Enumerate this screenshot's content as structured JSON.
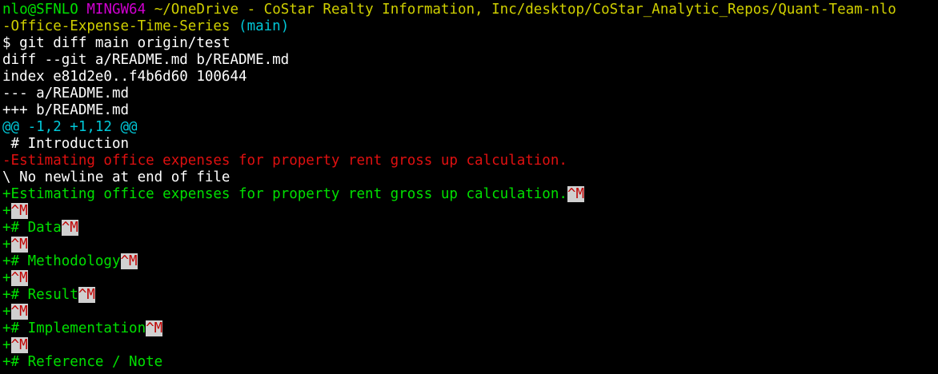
{
  "prompt": {
    "user_host": "nlo@SFNLO",
    "system": "MINGW64",
    "path_line1": "~/OneDrive - CoStar Realty Information, Inc/desktop/CoStar_Analytic_Repos/Quant-Team-nlo",
    "path_line2": "-Office-Expense-Time-Series",
    "branch": "(main)",
    "symbol": "$",
    "command": "git diff main origin/test"
  },
  "diff": {
    "header": "diff --git a/README.md b/README.md",
    "index": "index e81d2e0..f4b6d60 100644",
    "old_file": "--- a/README.md",
    "new_file": "+++ b/README.md",
    "hunk": "@@ -1,2 +1,12 @@",
    "context_intro": " # Introduction",
    "removed_line": "-Estimating office expenses for property rent gross up calculation.",
    "no_newline": "\\ No newline at end of file",
    "added": {
      "estimating": "+Estimating office expenses for property rent gross up calculation.",
      "plus": "+",
      "data": "+# Data",
      "methodology": "+# Methodology",
      "result": "+# Result",
      "implementation": "+# Implementation",
      "reference": "+# Reference / Note"
    },
    "cr_marker": "^M",
    "cut_off_line": "+ · · · · · · · · · · · "
  },
  "colors": {
    "background": "#000000",
    "green": "#00e000",
    "magenta": "#d000d0",
    "yellow": "#d0d000",
    "cyan": "#00c8d8",
    "red": "#e01010",
    "white": "#ffffff"
  }
}
